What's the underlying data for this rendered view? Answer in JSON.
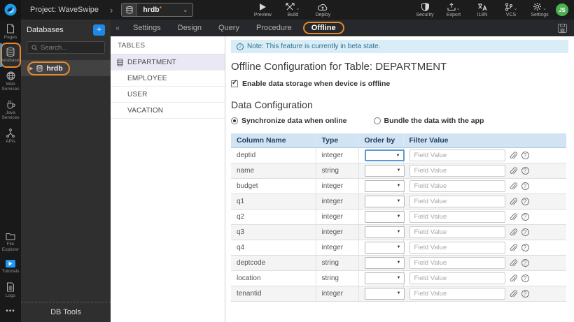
{
  "topbar": {
    "project_label": "Project: WaveSwipe",
    "db_selector": {
      "value": "hrdb",
      "dirty_marker": "*"
    },
    "left_actions": [
      {
        "label": "Preview",
        "icon": "play-icon",
        "caret": false
      },
      {
        "label": "Build",
        "icon": "build-icon",
        "caret": true
      },
      {
        "label": "Deploy",
        "icon": "deploy-cloud-icon",
        "caret": false
      }
    ],
    "right_actions": [
      {
        "label": "Security",
        "icon": "shield-icon",
        "caret": false
      },
      {
        "label": "Export",
        "icon": "export-icon",
        "caret": true
      },
      {
        "label": "I18N",
        "icon": "translate-icon",
        "caret": false
      },
      {
        "label": "VCS",
        "icon": "branch-icon",
        "caret": true
      },
      {
        "label": "Settings",
        "icon": "gear-icon",
        "caret": true
      }
    ],
    "avatar_initials": "JS"
  },
  "sidebar": {
    "top_items": [
      {
        "label": "Pages",
        "icon": "page-icon",
        "selected": false,
        "annotated": false
      },
      {
        "label": "Databases",
        "icon": "database-icon",
        "selected": true,
        "annotated": true
      },
      {
        "label": "Web Services",
        "icon": "globe-icon",
        "selected": false,
        "annotated": false
      },
      {
        "label": "Java Services",
        "icon": "coffee-icon",
        "selected": false,
        "annotated": false
      },
      {
        "label": "APIs",
        "icon": "api-icon",
        "selected": false,
        "annotated": false
      }
    ],
    "bottom_items": [
      {
        "label": "File Explorer",
        "icon": "folder-icon",
        "selected": false,
        "annotated": false
      },
      {
        "label": "Tutorials",
        "icon": "tutorials-play-icon",
        "selected": false,
        "annotated": false
      },
      {
        "label": "Logs",
        "icon": "logs-icon",
        "selected": false,
        "annotated": false
      }
    ],
    "more_label": "•••"
  },
  "db_panel": {
    "title": "Databases",
    "add_button": "+",
    "search_placeholder": "Search...",
    "tree_item": "hrdb",
    "footer": "DB Tools"
  },
  "tabbar": {
    "collapse": "«",
    "tabs": [
      {
        "label": "Settings",
        "active": false
      },
      {
        "label": "Design",
        "active": false
      },
      {
        "label": "Query",
        "active": false
      },
      {
        "label": "Procedure",
        "active": false
      },
      {
        "label": "Offline",
        "active": true
      }
    ]
  },
  "tables_panel": {
    "title": "TABLES",
    "items": [
      {
        "label": "DEPARTMENT",
        "selected": true
      },
      {
        "label": "EMPLOYEE",
        "selected": false
      },
      {
        "label": "USER",
        "selected": false
      },
      {
        "label": "VACATION",
        "selected": false
      }
    ]
  },
  "offline": {
    "note": "Note: This feature is currently in beta state.",
    "title": "Offline Configuration for Table: DEPARTMENT",
    "enable_label": "Enable data storage when device is offline",
    "enable_checked": true,
    "section_title": "Data Configuration",
    "radio_options": [
      {
        "label": "Synchronize data when online",
        "selected": true
      },
      {
        "label": "Bundle the data with the app",
        "selected": false
      }
    ],
    "grid": {
      "headers": [
        "Column Name",
        "Type",
        "Order by",
        "Filter Value"
      ],
      "filter_placeholder": "Field Value",
      "rows": [
        {
          "name": "deptid",
          "type": "integer",
          "order_by": "",
          "filter_value": "",
          "focused": true
        },
        {
          "name": "name",
          "type": "string",
          "order_by": "",
          "filter_value": "",
          "focused": false
        },
        {
          "name": "budget",
          "type": "integer",
          "order_by": "",
          "filter_value": "",
          "focused": false
        },
        {
          "name": "q1",
          "type": "integer",
          "order_by": "",
          "filter_value": "",
          "focused": false
        },
        {
          "name": "q2",
          "type": "integer",
          "order_by": "",
          "filter_value": "",
          "focused": false
        },
        {
          "name": "q3",
          "type": "integer",
          "order_by": "",
          "filter_value": "",
          "focused": false
        },
        {
          "name": "q4",
          "type": "integer",
          "order_by": "",
          "filter_value": "",
          "focused": false
        },
        {
          "name": "deptcode",
          "type": "string",
          "order_by": "",
          "filter_value": "",
          "focused": false
        },
        {
          "name": "location",
          "type": "string",
          "order_by": "",
          "filter_value": "",
          "focused": false
        },
        {
          "name": "tenantid",
          "type": "integer",
          "order_by": "",
          "filter_value": "",
          "focused": false
        }
      ]
    }
  },
  "colors": {
    "annotation_orange": "#e8872b",
    "accent_blue": "#1e88e5",
    "note_bg": "#d9edf7",
    "note_text": "#2e6e8e",
    "grid_header_bg": "#d2e4f4",
    "avatar_green": "#4caf50"
  }
}
